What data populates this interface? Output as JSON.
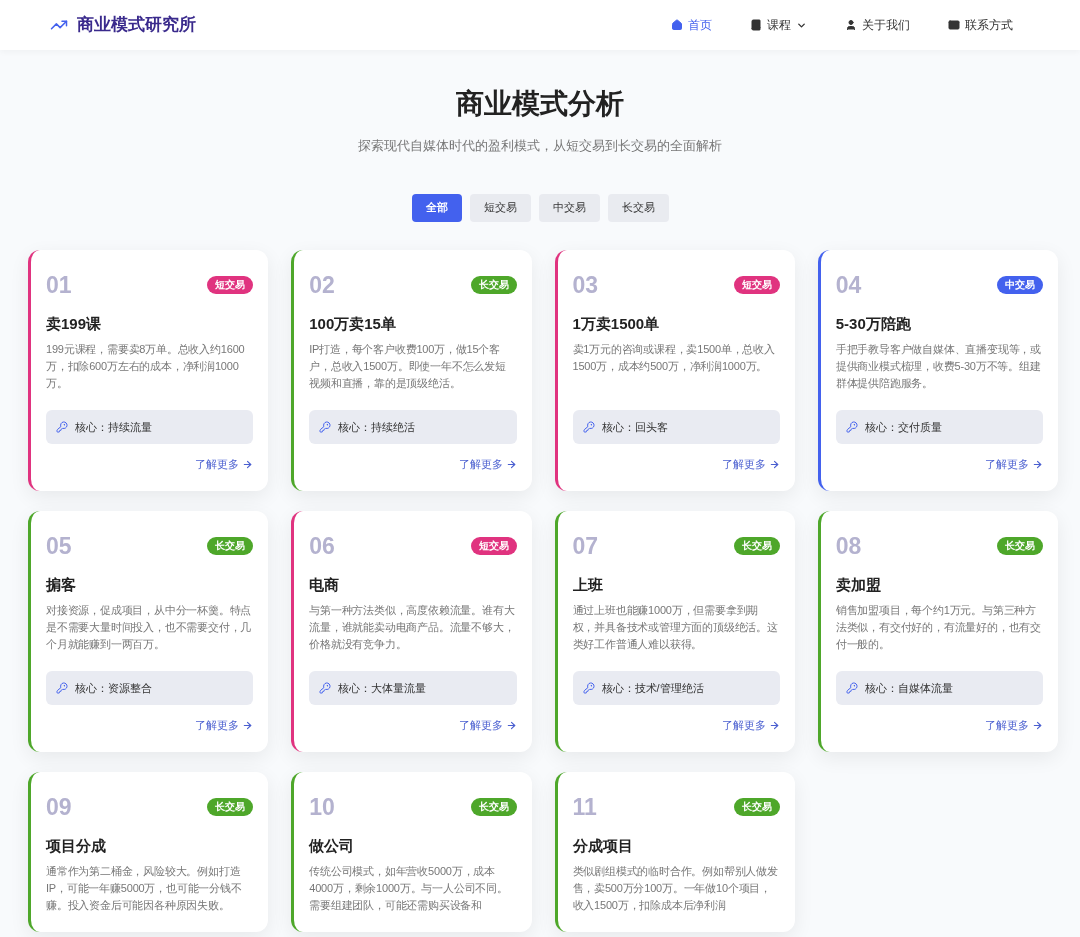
{
  "brand": {
    "name": "商业模式研究所"
  },
  "nav": [
    {
      "label": "首页",
      "selected": true,
      "dropdown": false
    },
    {
      "label": "课程",
      "selected": false,
      "dropdown": true
    },
    {
      "label": "关于我们",
      "selected": false,
      "dropdown": false
    },
    {
      "label": "联系方式",
      "selected": false,
      "dropdown": false
    }
  ],
  "hero": {
    "title": "商业模式分析",
    "subtitle": "探索现代自媒体时代的盈利模式，从短交易到长交易的全面解析"
  },
  "filters": [
    {
      "label": "全部",
      "selected": true
    },
    {
      "label": "短交易",
      "selected": false
    },
    {
      "label": "中交易",
      "selected": false
    },
    {
      "label": "长交易",
      "selected": false
    }
  ],
  "cards": [
    {
      "number": "01",
      "tag": "短交易",
      "color": "#e0337f",
      "title": "卖199课",
      "description": "199元课程，需要卖8万单。总收入约1600万，扣除600万左右的成本，净利润1000万。",
      "core": "核心：持续流量",
      "link": "了解更多"
    },
    {
      "number": "02",
      "tag": "长交易",
      "color": "#4ea72a",
      "title": "100万卖15单",
      "description": "IP打造，每个客户收费100万，做15个客户，总收入1500万。即使一年不怎么发短视频和直播，靠的是顶级绝活。",
      "core": "核心：持续绝活",
      "link": "了解更多"
    },
    {
      "number": "03",
      "tag": "短交易",
      "color": "#e0337f",
      "title": "1万卖1500单",
      "description": "卖1万元的咨询或课程，卖1500单，总收入1500万，成本约500万，净利润1000万。",
      "core": "核心：回头客",
      "link": "了解更多"
    },
    {
      "number": "04",
      "tag": "中交易",
      "color": "#4361ee",
      "title": "5-30万陪跑",
      "description": "手把手教导客户做自媒体、直播变现等，或提供商业模式梳理，收费5-30万不等。组建群体提供陪跑服务。",
      "core": "核心：交付质量",
      "link": "了解更多"
    },
    {
      "number": "05",
      "tag": "长交易",
      "color": "#4ea72a",
      "title": "掮客",
      "description": "对接资源，促成项目，从中分一杯羹。特点是不需要大量时间投入，也不需要交付，几个月就能赚到一两百万。",
      "core": "核心：资源整合",
      "link": "了解更多"
    },
    {
      "number": "06",
      "tag": "短交易",
      "color": "#e0337f",
      "title": "电商",
      "description": "与第一种方法类似，高度依赖流量。谁有大流量，谁就能卖动电商产品。流量不够大，价格就没有竞争力。",
      "core": "核心：大体量流量",
      "link": "了解更多"
    },
    {
      "number": "07",
      "tag": "长交易",
      "color": "#4ea72a",
      "title": "上班",
      "description": "通过上班也能赚1000万，但需要拿到期权，并具备技术或管理方面的顶级绝活。这类好工作普通人难以获得。",
      "core": "核心：技术/管理绝活",
      "link": "了解更多"
    },
    {
      "number": "08",
      "tag": "长交易",
      "color": "#4ea72a",
      "title": "卖加盟",
      "description": "销售加盟项目，每个约1万元。与第三种方法类似，有交付好的，有流量好的，也有交付一般的。",
      "core": "核心：自媒体流量",
      "link": "了解更多"
    },
    {
      "number": "09",
      "tag": "长交易",
      "color": "#4ea72a",
      "title": "项目分成",
      "description": "通常作为第二桶金，风险较大。例如打造IP，可能一年赚5000万，也可能一分钱不赚。投入资金后可能因各种原因失败。"
    },
    {
      "number": "10",
      "tag": "长交易",
      "color": "#4ea72a",
      "title": "做公司",
      "description": "传统公司模式，如年营收5000万，成本4000万，剩余1000万。与一人公司不同。需要组建团队，可能还需购买设备和"
    },
    {
      "number": "11",
      "tag": "长交易",
      "color": "#4ea72a",
      "title": "分成项目",
      "description": "类似剧组模式的临时合作。例如帮别人做发售，卖500万分100万。一年做10个项目，收入1500万，扣除成本后净利润"
    }
  ]
}
